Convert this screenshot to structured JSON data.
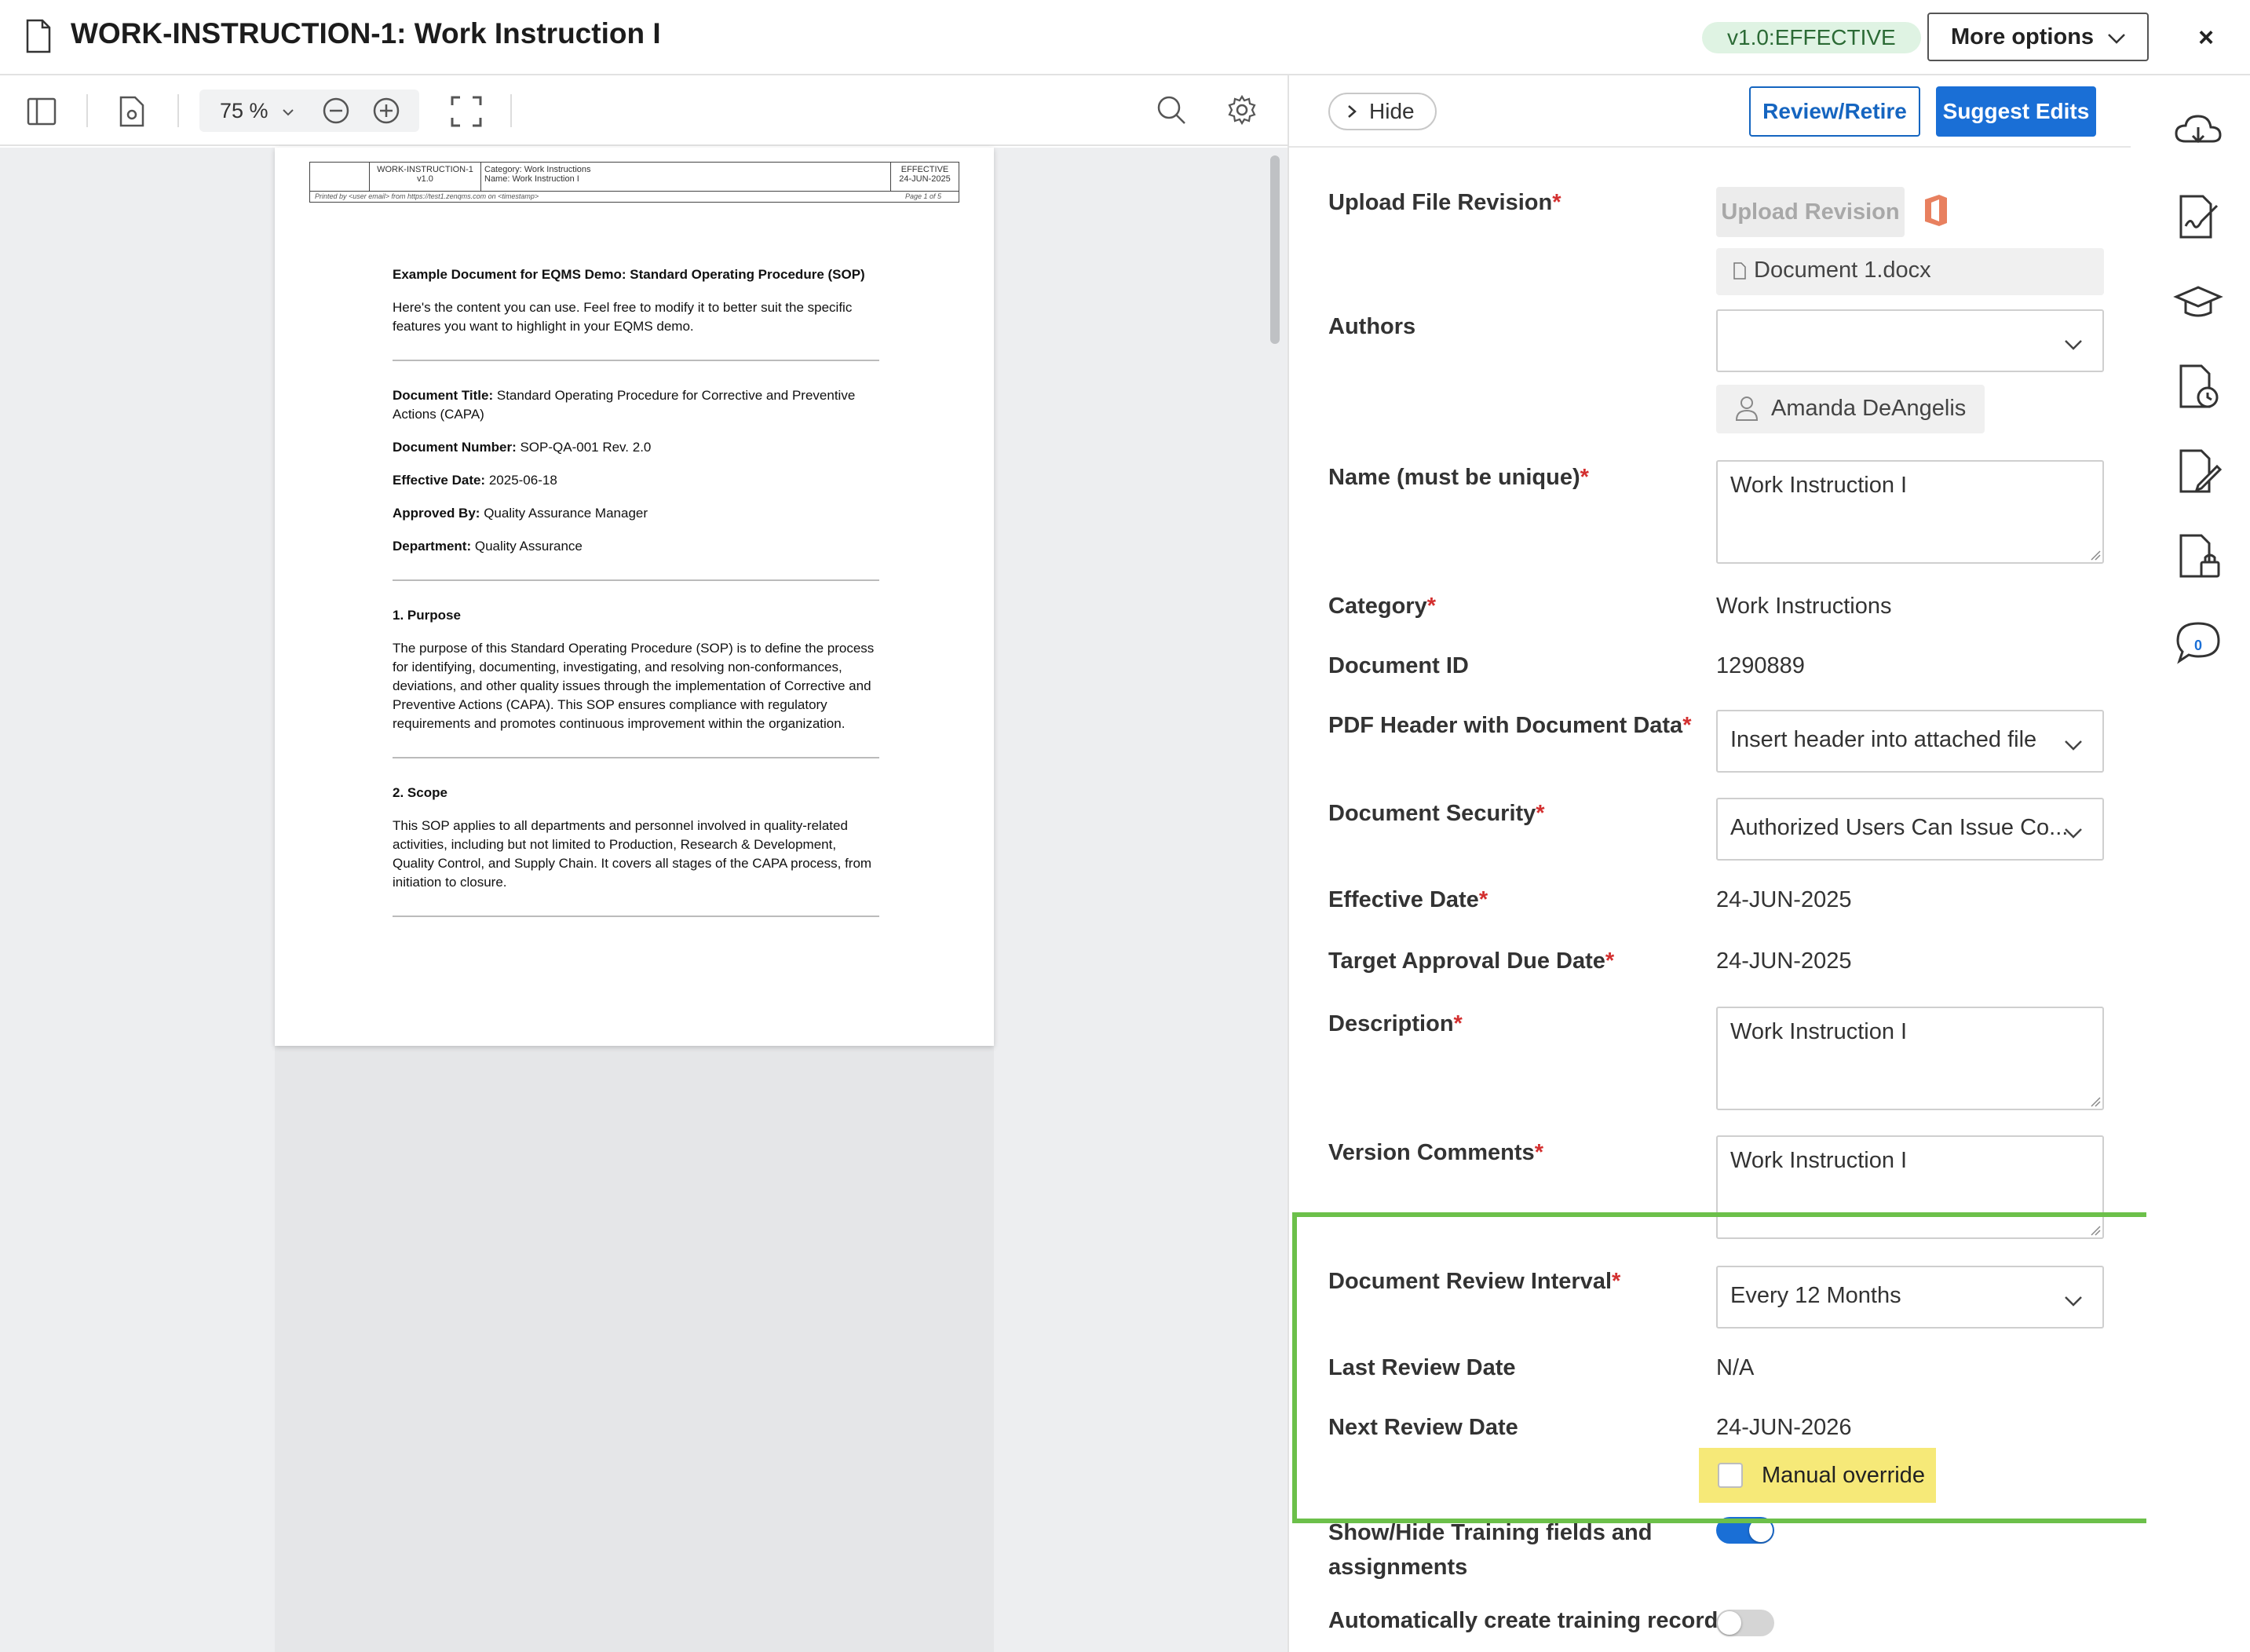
{
  "header": {
    "title": "WORK-INSTRUCTION-1: Work Instruction I",
    "status": "v1.0:EFFECTIVE",
    "more_options": "More options",
    "close": "×"
  },
  "viewer": {
    "zoom": "75 %",
    "pdf_header": {
      "doc_id": "WORK-INSTRUCTION-1",
      "version": "v1.0",
      "category": "Category: Work Instructions",
      "name": "Name: Work Instruction I",
      "status": "EFFECTIVE",
      "date": "24-JUN-2025",
      "printed_by": "Printed by <user email> from https://test1.zenqms.com on <timestamp>",
      "page": "Page 1 of 5"
    },
    "pdf_content": {
      "title": "Example Document for EQMS Demo: Standard Operating Procedure (SOP)",
      "intro": "Here's the content you can use. Feel free to modify it to better suit the specific features you want to highlight in your EQMS demo.",
      "doc_title_label": "Document Title:",
      "doc_title_value": " Standard Operating Procedure for Corrective and Preventive Actions (CAPA)",
      "doc_number_label": "Document Number:",
      "doc_number_value": " SOP-QA-001 Rev. 2.0",
      "effective_label": "Effective Date:",
      "effective_value": " 2025-06-18",
      "approved_label": "Approved By:",
      "approved_value": " Quality Assurance Manager",
      "department_label": "Department:",
      "department_value": " Quality Assurance",
      "purpose_heading": "1. Purpose",
      "purpose_text": "The purpose of this Standard Operating Procedure (SOP) is to define the process for identifying, documenting, investigating, and resolving non-conformances, deviations, and other quality issues through the implementation of Corrective and Preventive Actions (CAPA). This SOP ensures compliance with regulatory requirements and promotes continuous improvement within the organization.",
      "scope_heading": "2. Scope",
      "scope_text": "This SOP applies to all departments and personnel involved in quality-related activities, including but not limited to Production, Research & Development, Quality Control, and Supply Chain. It covers all stages of the CAPA process, from initiation to closure."
    }
  },
  "panel": {
    "hide": "Hide",
    "review_retire": "Review/Retire",
    "suggest_edits": "Suggest Edits",
    "fields": {
      "upload_label": "Upload File Revision",
      "upload_button": "Upload Revision",
      "file_name": "Document 1.docx",
      "authors_label": "Authors",
      "author_name": "Amanda DeAngelis",
      "name_label": "Name (must be unique)",
      "name_value": "Work Instruction I",
      "category_label": "Category",
      "category_value": "Work Instructions",
      "doc_id_label": "Document ID",
      "doc_id_value": "1290889",
      "pdf_header_label": "PDF Header with Document Data",
      "pdf_header_value": "Insert header into attached file",
      "security_label": "Document Security",
      "security_value": "Authorized Users Can Issue Co...",
      "effective_label": "Effective Date",
      "effective_value": "24-JUN-2025",
      "target_label": "Target Approval Due Date",
      "target_value": "24-JUN-2025",
      "description_label": "Description",
      "description_value": "Work Instruction I",
      "version_comments_label": "Version Comments",
      "version_comments_value": "Work Instruction I",
      "review_interval_label": "Document Review Interval",
      "review_interval_value": "Every 12 Months",
      "last_review_label": "Last Review Date",
      "last_review_value": "N/A",
      "next_review_label": "Next Review Date",
      "next_review_value": "24-JUN-2026",
      "manual_override": "Manual override",
      "training_label": "Show/Hide Training fields and assignments",
      "auto_training_label": "Automatically create training records"
    }
  },
  "rail": {
    "comment_count": "0"
  },
  "colors": {
    "accent": "#1a6fd6",
    "status_bg": "#dff3e3",
    "highlight_border": "#6cc04a",
    "override_bg": "#f6e978",
    "required": "#d32f2f"
  }
}
